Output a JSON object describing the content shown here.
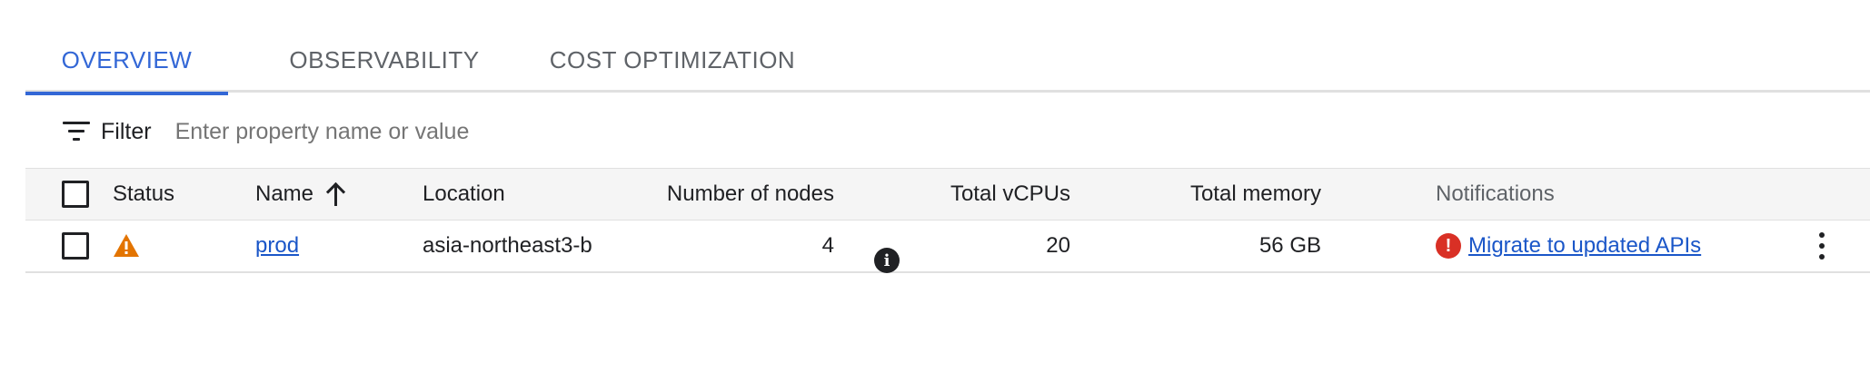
{
  "tabs": [
    {
      "label": "OVERVIEW",
      "active": true
    },
    {
      "label": "OBSERVABILITY",
      "active": false
    },
    {
      "label": "COST OPTIMIZATION",
      "active": false
    }
  ],
  "filter": {
    "label": "Filter",
    "placeholder": "Enter property name or value",
    "icon": "filter-icon"
  },
  "table": {
    "columns": {
      "status": "Status",
      "name": "Name",
      "location": "Location",
      "nodes": "Number of nodes",
      "vcpus": "Total vCPUs",
      "memory": "Total memory",
      "notifications": "Notifications"
    },
    "sort": {
      "column": "name",
      "direction": "ascending"
    },
    "rows": [
      {
        "status": "warning",
        "name": "prod",
        "location": "asia-northeast3-b",
        "nodes": "4",
        "vcpus": "20",
        "memory": "56 GB",
        "notification": "Migrate to updated APIs",
        "notification_level": "error"
      }
    ]
  },
  "colors": {
    "accent": "#3367d6",
    "warning": "#e37400",
    "error": "#d93025",
    "link": "#1a56c8"
  }
}
